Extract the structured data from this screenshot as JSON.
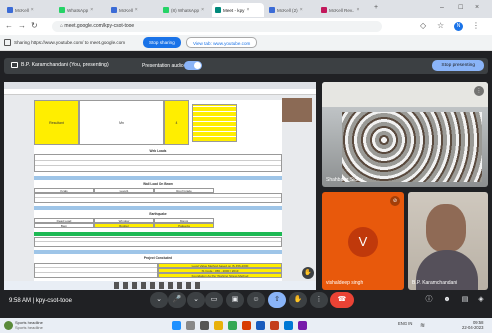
{
  "tabs": [
    {
      "label": "McKell",
      "color": "#3b6bd6"
    },
    {
      "label": "WhatsApp",
      "color": "#25d366"
    },
    {
      "label": "McKell",
      "color": "#3b6bd6"
    },
    {
      "label": "(8) WhatsApp",
      "color": "#25d366"
    },
    {
      "label": "Meet - kpy",
      "color": "#00897b"
    },
    {
      "label": "McKell (2)",
      "color": "#3b6bd6"
    },
    {
      "label": "McKell Rev..",
      "color": "#c2185b"
    }
  ],
  "url": "meet.google.com/kpy-csot-tooe",
  "share": {
    "text": "Sharing https://www.youtube.com/ to meet.google.com",
    "stop": "Stop sharing",
    "view": "View tab: www.youtube.com"
  },
  "presenter": "B.P. Karamchandani (You, presenting)",
  "presentation_audio": "Presentation audio",
  "stop_presenting": "Stop presenting",
  "doc": {
    "title_left": "Resultant",
    "title_mid": "Mn",
    "title_right": "4",
    "s1": "Web Loads",
    "s2": "Wall Load On Beam",
    "s3": "Earthquake",
    "s4": "Project Concluded",
    "b1": "Kcals",
    "b2": "Level1",
    "b3": "Roof Grade",
    "b4": "Dead Load",
    "b5": "Window",
    "b6": "Manoj",
    "b7": "Bam",
    "b8": "Rodger",
    "b9": "Pakeeza",
    "r1": "Level Value Method based on IS 456-2000",
    "r2": "IS Code : 456 - 2000 / 2013",
    "r3": "Foundation As Per Working Stress Method"
  },
  "participants": [
    {
      "name": "Shahbaaz Sidhu"
    },
    {
      "name": "vishaldeep singh",
      "initial": "V"
    },
    {
      "name": "B.P. Karamchandani"
    }
  ],
  "time": "9:58 AM",
  "meeting_code": "kpy-csot-tooe",
  "taskbar": {
    "weather": "Sports headline",
    "weather_sub": "Sports headline",
    "lang": "ENG IN",
    "clock": "09:58",
    "date": "22-04-2023"
  },
  "colors": {
    "accent": "#1a73e8",
    "meet_bg": "#202124",
    "end_call": "#ea4335",
    "highlight": "#ffee00"
  }
}
